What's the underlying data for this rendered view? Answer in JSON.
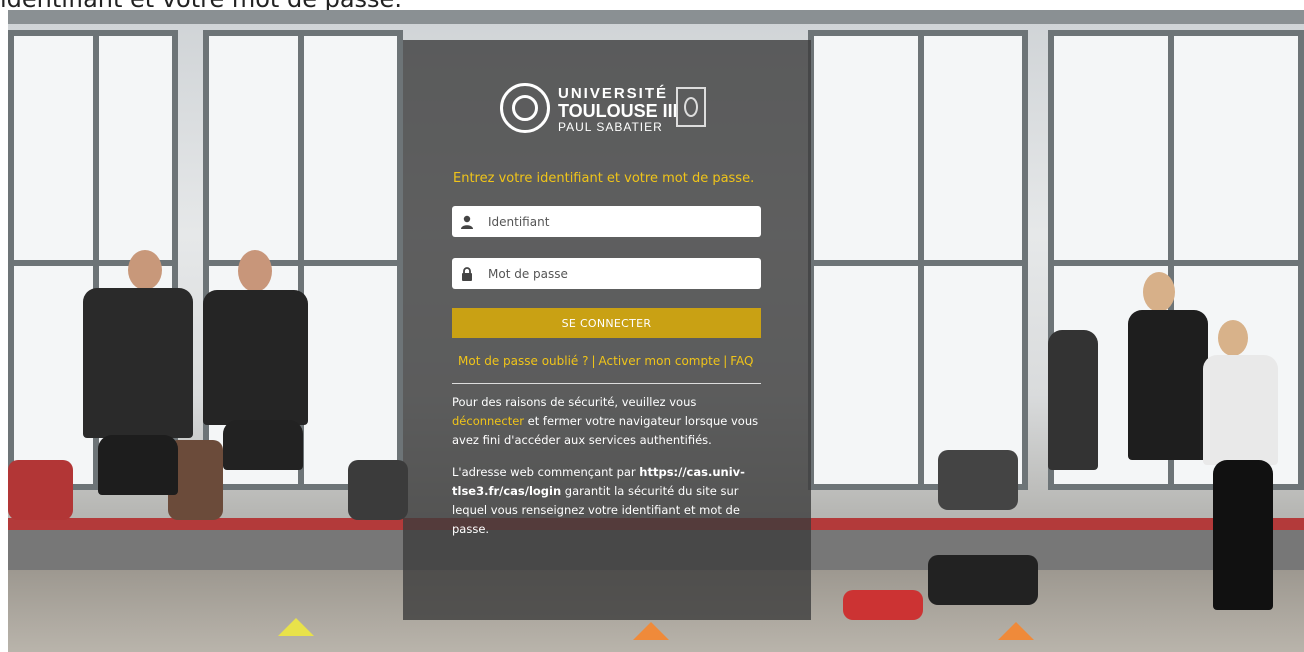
{
  "top_title": "identifiant et votre mot de passe.",
  "logo": {
    "line1": "UNIVERSITÉ",
    "line2": "TOULOUSE III",
    "line3": "PAUL SABATIER"
  },
  "login": {
    "prompt": "Entrez votre identifiant et votre mot de passe.",
    "username": {
      "value": "",
      "placeholder": "Identifiant",
      "icon": "user-icon"
    },
    "password": {
      "value": "",
      "placeholder": "Mot de passe",
      "icon": "lock-icon"
    },
    "submit_label": "SE CONNECTER"
  },
  "links": {
    "forgot": "Mot de passe oublié ?",
    "activate": "Activer mon compte",
    "faq": "FAQ",
    "separator": "|"
  },
  "message1": {
    "before": "Pour des raisons de sécurité, veuillez vous ",
    "link": "déconnecter",
    "after": " et fermer votre navigateur lorsque vous avez fini d'accéder aux services authentifiés."
  },
  "message2": {
    "before": "L'adresse web commençant par ",
    "url": "https://cas.univ-tlse3.fr/cas/login",
    "after": " garantit la sécurité du site sur lequel vous renseignez votre identifiant et mot de passe."
  },
  "colors": {
    "accent": "#f0c419",
    "button": "#c9a114",
    "panel": "rgba(60,60,60,0.80)"
  }
}
